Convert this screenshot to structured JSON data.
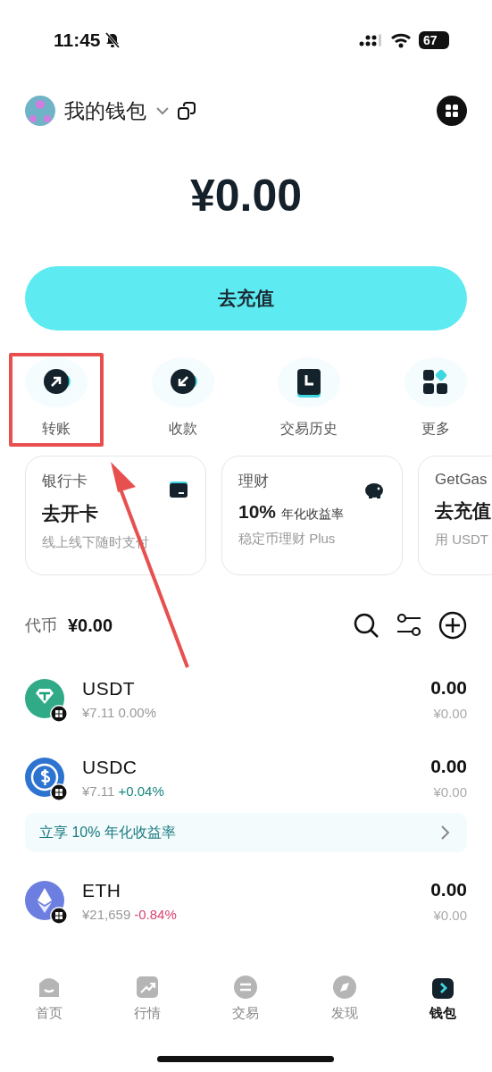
{
  "status_bar": {
    "time": "11:45",
    "battery": "67"
  },
  "header": {
    "wallet_name": "我的钱包"
  },
  "balance": "¥0.00",
  "deposit_button": "去充值",
  "actions": [
    {
      "kind": "send",
      "label": "转账",
      "highlighted": true
    },
    {
      "kind": "receive",
      "label": "收款",
      "highlighted": false
    },
    {
      "kind": "history",
      "label": "交易历史",
      "highlighted": false
    },
    {
      "kind": "more",
      "label": "更多",
      "highlighted": false
    }
  ],
  "cards": [
    {
      "kind": "card",
      "title": "银行卡",
      "headline": "去开卡",
      "subtitle": "线上线下随时支付"
    },
    {
      "kind": "piggy",
      "title": "理财",
      "headline": "10%",
      "headline_note": "年化收益率",
      "subtitle": "稳定币理财 Plus"
    },
    {
      "kind": "none",
      "title": "GetGas",
      "headline": "去充值",
      "subtitle": "用 USDT"
    }
  ],
  "tokens_header": {
    "label": "代币",
    "total": "¥0.00"
  },
  "tokens": [
    {
      "kind": "usdt",
      "symbol": "USDT",
      "price": "¥7.11",
      "change": "0.00%",
      "color": "#999999",
      "amount": "0.00",
      "value": "¥0.00"
    },
    {
      "kind": "usdc",
      "symbol": "USDC",
      "price": "¥7.11",
      "change": "+0.04%",
      "color": "#18867e",
      "amount": "0.00",
      "value": "¥0.00"
    },
    {
      "kind": "banner",
      "text": "立享 10% 年化收益率"
    },
    {
      "kind": "eth",
      "symbol": "ETH",
      "price": "¥21,659",
      "change": "-0.84%",
      "color": "#d9446e",
      "amount": "0.00",
      "value": "¥0.00"
    }
  ],
  "tab_bar": [
    {
      "kind": "home",
      "label": "首页",
      "selected": false
    },
    {
      "kind": "market",
      "label": "行情",
      "selected": false
    },
    {
      "kind": "trade",
      "label": "交易",
      "selected": false
    },
    {
      "kind": "discover",
      "label": "发现",
      "selected": false
    },
    {
      "kind": "wallet",
      "label": "钱包",
      "selected": true
    }
  ]
}
